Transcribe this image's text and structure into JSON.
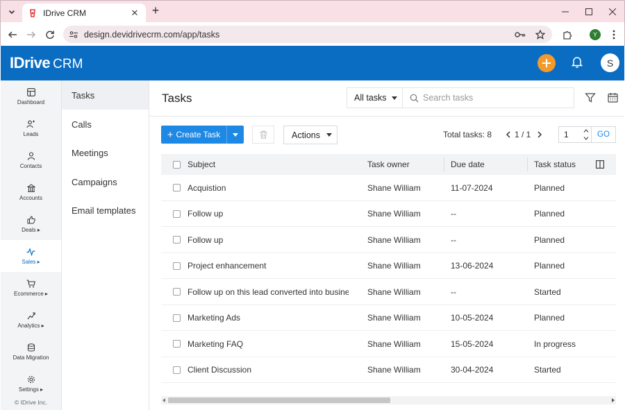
{
  "browser": {
    "tab_title": "IDrive CRM",
    "url": "design.devidrivecrm.com/app/tasks",
    "profile_initial": "Y"
  },
  "header": {
    "brand": "IDrive",
    "product": "CRM",
    "user_initial": "S",
    "accent_color": "#0a6dc2",
    "add_color": "#f39a2b"
  },
  "rail": {
    "items": [
      {
        "label": "Dashboard",
        "icon": "dashboard-icon"
      },
      {
        "label": "Leads",
        "icon": "leads-icon"
      },
      {
        "label": "Contacts",
        "icon": "contacts-icon"
      },
      {
        "label": "Accounts",
        "icon": "accounts-icon"
      },
      {
        "label": "Deals ▸",
        "icon": "deals-icon"
      },
      {
        "label": "Sales ▸",
        "icon": "sales-icon",
        "active": true
      },
      {
        "label": "Ecommerce ▸",
        "icon": "ecommerce-icon"
      },
      {
        "label": "Analytics ▸",
        "icon": "analytics-icon"
      },
      {
        "label": "Data Migration",
        "icon": "data-migration-icon"
      },
      {
        "label": "Settings ▸",
        "icon": "settings-icon"
      }
    ],
    "copyright": "© IDrive Inc."
  },
  "subnav": {
    "items": [
      {
        "label": "Tasks",
        "active": true
      },
      {
        "label": "Calls"
      },
      {
        "label": "Meetings"
      },
      {
        "label": "Campaigns"
      },
      {
        "label": "Email templates"
      }
    ]
  },
  "main": {
    "title": "Tasks",
    "filter_label": "All tasks",
    "search_placeholder": "Search tasks",
    "create_label": "Create Task",
    "actions_label": "Actions",
    "total_label": "Total tasks: 8",
    "page_text": "1 / 1",
    "page_input": "1",
    "go_label": "GO"
  },
  "table": {
    "columns": [
      "Subject",
      "Task owner",
      "Due date",
      "Task status"
    ],
    "rows": [
      {
        "subject": "Acquistion",
        "owner": "Shane William",
        "due": "11-07-2024",
        "status": "Planned"
      },
      {
        "subject": "Follow up",
        "owner": "Shane William",
        "due": "--",
        "status": "Planned"
      },
      {
        "subject": "Follow up",
        "owner": "Shane William",
        "due": "--",
        "status": "Planned"
      },
      {
        "subject": "Project enhancement",
        "owner": "Shane William",
        "due": "13-06-2024",
        "status": "Planned"
      },
      {
        "subject": "Follow up on this lead converted into busine...",
        "owner": "Shane William",
        "due": "--",
        "status": "Started"
      },
      {
        "subject": "Marketing Ads",
        "owner": "Shane William",
        "due": "10-05-2024",
        "status": "Planned"
      },
      {
        "subject": "Marketing FAQ",
        "owner": "Shane William",
        "due": "15-05-2024",
        "status": "In progress"
      },
      {
        "subject": "Client Discussion",
        "owner": "Shane William",
        "due": "30-04-2024",
        "status": "Started"
      }
    ]
  }
}
